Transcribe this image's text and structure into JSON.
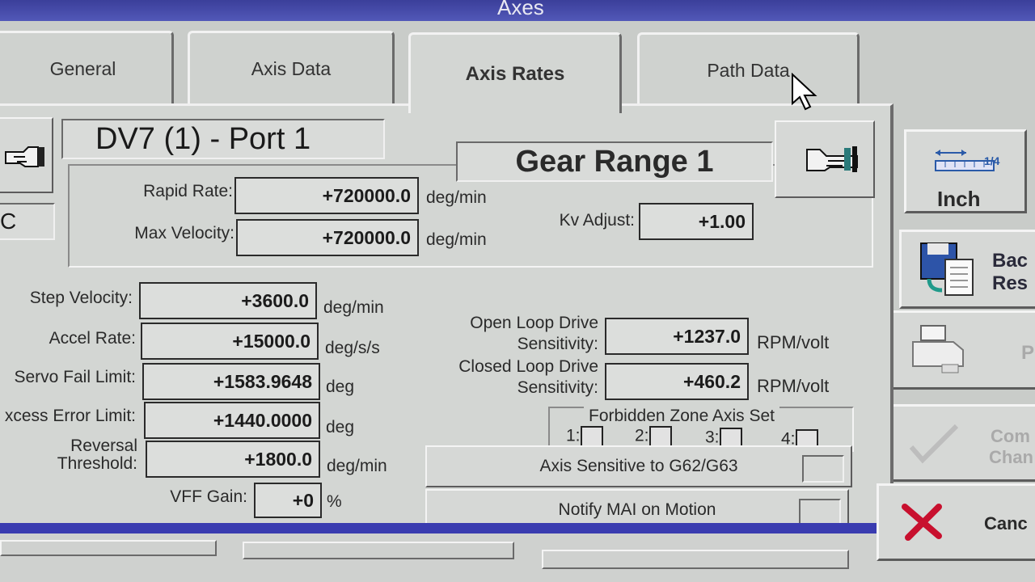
{
  "window": {
    "title": "Axes"
  },
  "tabs": [
    {
      "label": "General"
    },
    {
      "label": "Axis Data"
    },
    {
      "label": "Axis Rates"
    },
    {
      "label": "Path Data"
    }
  ],
  "header": {
    "axis_name": "DV7 (1) - Port 1",
    "gear_range": "Gear Range 1",
    "left_field_text": "C"
  },
  "rates": {
    "rapid_rate": {
      "label": "Rapid Rate:",
      "value": "+720000.0",
      "unit": "deg/min"
    },
    "max_velocity": {
      "label": "Max Velocity:",
      "value": "+720000.0",
      "unit": "deg/min"
    },
    "kv_adjust": {
      "label": "Kv Adjust:",
      "value": "+1.00"
    }
  },
  "params": {
    "step_velocity": {
      "label": "Step Velocity:",
      "value": "+3600.0",
      "unit": "deg/min"
    },
    "accel_rate": {
      "label": "Accel Rate:",
      "value": "+15000.0",
      "unit": "deg/s/s"
    },
    "servo_fail_limit": {
      "label": "Servo Fail Limit:",
      "value": "+1583.9648",
      "unit": "deg"
    },
    "excess_error_limit": {
      "label": "xcess Error Limit:",
      "value": "+1440.0000",
      "unit": "deg"
    },
    "reversal_threshold": {
      "label_line1": "Reversal",
      "label_line2": "Threshold:",
      "value": "+1800.0",
      "unit": "deg/min"
    },
    "vff_gain": {
      "label": "VFF Gain:",
      "value": "+0",
      "unit": "%"
    }
  },
  "drive": {
    "open_loop": {
      "label_line1": "Open Loop Drive",
      "label_line2": "Sensitivity:",
      "value": "+1237.0",
      "unit": "RPM/volt"
    },
    "closed_loop": {
      "label_line1": "Closed Loop Drive",
      "label_line2": "Sensitivity:",
      "value": "+460.2",
      "unit": "RPM/volt"
    }
  },
  "forbidden_zone": {
    "title": "Forbidden Zone Axis Set",
    "items": [
      {
        "label": "1:"
      },
      {
        "label": "2:"
      },
      {
        "label": "3:"
      },
      {
        "label": "4:"
      }
    ]
  },
  "toggles": {
    "g62_g63": "Axis Sensitive to G62/G63",
    "notify_mai": "Notify MAI on Motion"
  },
  "side_buttons": {
    "inch": "Inch",
    "inch_fraction": "1/4",
    "backup_line1": "Bac",
    "backup_line2": "Res",
    "print": "P",
    "commit_line1": "Com",
    "commit_line2": "Chan",
    "cancel": "Canc"
  },
  "icons": [
    "hand-pointer-left-icon",
    "hand-pointer-right-icon",
    "ruler-icon",
    "floppy-backup-icon",
    "printer-icon",
    "checkmark-icon",
    "red-x-icon",
    "mouse-cursor-icon"
  ],
  "colors": {
    "titlebar": "#3b3f9a",
    "accent_bar": "#3a3cb0",
    "cancel_x": "#c8102e"
  }
}
